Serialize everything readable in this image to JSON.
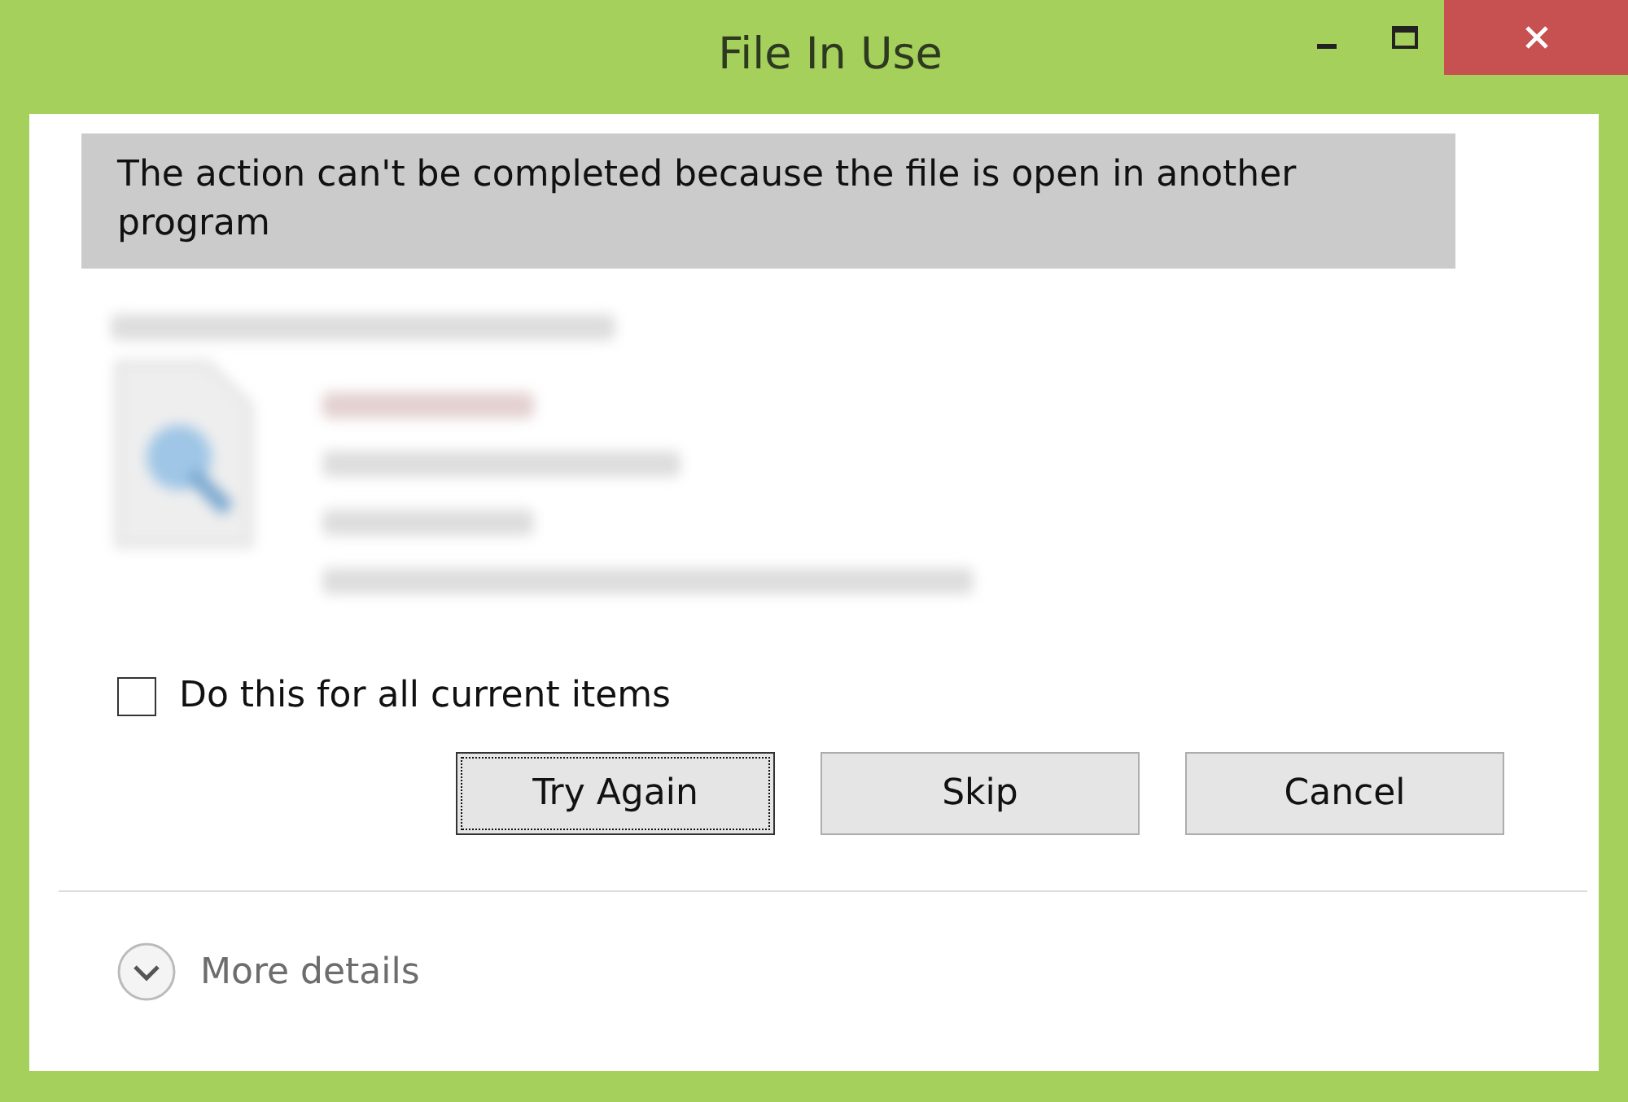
{
  "window": {
    "title": "File In Use"
  },
  "message": "The action can't be completed because the file is open in another program",
  "checkbox": {
    "label": "Do this for all current items",
    "checked": false
  },
  "buttons": [
    {
      "label": "Try Again",
      "focused": true
    },
    {
      "label": "Skip",
      "focused": false
    },
    {
      "label": "Cancel",
      "focused": false
    }
  ],
  "details_toggle": {
    "label": "More details",
    "expanded": false
  }
}
